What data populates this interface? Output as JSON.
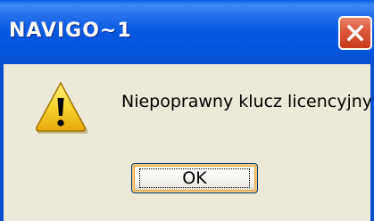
{
  "window": {
    "title": "NAVIGO~1"
  },
  "dialog": {
    "icon": "warning-icon",
    "message": "Niepoprawny klucz licencyjny"
  },
  "buttons": {
    "ok_label": "OK"
  },
  "colors": {
    "titlebar": "#0857e0",
    "close_button": "#dc5a3c",
    "background": "#ece9d8",
    "warning_yellow": "#f8d330"
  }
}
